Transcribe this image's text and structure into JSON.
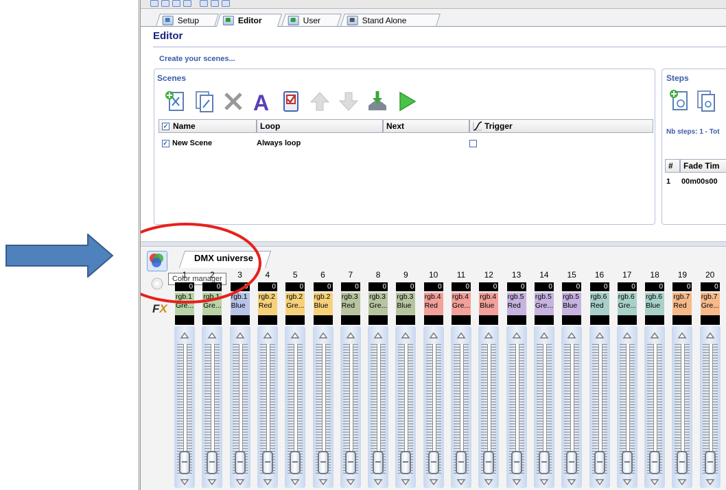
{
  "tabs": [
    {
      "label": "Setup",
      "active": false,
      "icon": "setup-icon"
    },
    {
      "label": "Editor",
      "active": true,
      "icon": "editor-icon"
    },
    {
      "label": "User",
      "active": false,
      "icon": "user-icon"
    },
    {
      "label": "Stand Alone",
      "active": false,
      "icon": "standalone-icon"
    }
  ],
  "editor": {
    "title": "Editor",
    "subtitle": "Create your scenes..."
  },
  "scenes": {
    "header": "Scenes",
    "toolbar_icons": [
      "add-scene-icon",
      "duplicate-scene-icon",
      "delete-icon",
      "rename-icon",
      "checklist-icon",
      "move-up-icon",
      "move-down-icon",
      "export-icon",
      "play-icon"
    ],
    "columns": {
      "name": "Name",
      "loop": "Loop",
      "next": "Next",
      "trigger": "Trigger"
    },
    "rows": [
      {
        "name": "New Scene",
        "loop": "Always loop",
        "next": "",
        "trigger": ""
      }
    ]
  },
  "steps": {
    "header": "Steps",
    "count": "Nb steps: 1 - Tot",
    "columns": {
      "num": "#",
      "fade": "Fade Tim"
    },
    "rows": [
      {
        "num": "1",
        "fade": "00m00s00"
      }
    ]
  },
  "bottom": {
    "tab": "DMX universe",
    "tooltip": "Color manager"
  },
  "channels": [
    {
      "num": "1",
      "value": "0",
      "label": "rgb.1 Gre...",
      "color": "#b9d3a6"
    },
    {
      "num": "2",
      "value": "0",
      "label": "rgb.1 Gre...",
      "color": "#b9d3a6"
    },
    {
      "num": "3",
      "value": "0",
      "label": "rgb.1 Blue",
      "color": "#b9c3e8"
    },
    {
      "num": "4",
      "value": "0",
      "label": "rgb.2 Red",
      "color": "#f7d17a"
    },
    {
      "num": "5",
      "value": "0",
      "label": "rgb.2 Gre...",
      "color": "#f7d17a"
    },
    {
      "num": "6",
      "value": "0",
      "label": "rgb.2 Blue",
      "color": "#f7d17a"
    },
    {
      "num": "7",
      "value": "0",
      "label": "rgb.3 Red",
      "color": "#b8c4a0"
    },
    {
      "num": "8",
      "value": "0",
      "label": "rgb.3 Gre...",
      "color": "#b8c4a0"
    },
    {
      "num": "9",
      "value": "0",
      "label": "rgb.3 Blue",
      "color": "#b8c4a0"
    },
    {
      "num": "10",
      "value": "0",
      "label": "rgb.4 Red",
      "color": "#f2a09a"
    },
    {
      "num": "11",
      "value": "0",
      "label": "rgb.4 Gre...",
      "color": "#f2a09a"
    },
    {
      "num": "12",
      "value": "0",
      "label": "rgb.4 Blue",
      "color": "#f2a09a"
    },
    {
      "num": "13",
      "value": "0",
      "label": "rgb.5 Red",
      "color": "#c7b3e0"
    },
    {
      "num": "14",
      "value": "0",
      "label": "rgb.5 Gre...",
      "color": "#c7b3e0"
    },
    {
      "num": "15",
      "value": "0",
      "label": "rgb.5 Blue",
      "color": "#c7b3e0"
    },
    {
      "num": "16",
      "value": "0",
      "label": "rgb.6 Red",
      "color": "#a8d0c9"
    },
    {
      "num": "17",
      "value": "0",
      "label": "rgb.6 Gre...",
      "color": "#a8d0c9"
    },
    {
      "num": "18",
      "value": "0",
      "label": "rgb.6 Blue",
      "color": "#a8d0c9"
    },
    {
      "num": "19",
      "value": "0",
      "label": "rgb.7 Red",
      "color": "#f5b98a"
    },
    {
      "num": "20",
      "value": "0",
      "label": "rgb.7 Gre...",
      "color": "#f5b98a"
    }
  ]
}
